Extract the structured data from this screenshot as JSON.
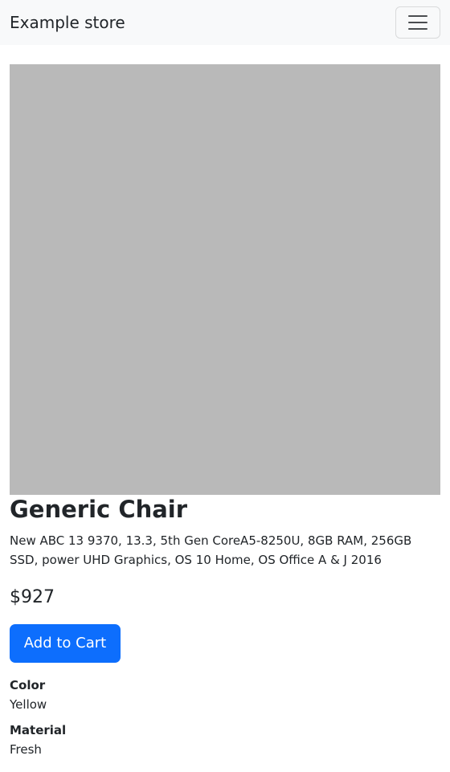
{
  "navbar": {
    "brand": "Example store",
    "toggler_icon": "hamburger-menu-icon"
  },
  "product": {
    "image_placeholder_color": "#b9b9b9",
    "title": "Generic Chair",
    "description": "New ABC 13 9370, 13.3, 5th Gen CoreA5-8250U, 8GB RAM, 256GB SSD, power UHD Graphics, OS 10 Home, OS Office A & J 2016",
    "price": "$927",
    "add_to_cart_label": "Add to Cart",
    "attributes": [
      {
        "label": "Color",
        "value": "Yellow"
      },
      {
        "label": "Material",
        "value": "Fresh"
      }
    ]
  },
  "colors": {
    "navbar_bg": "#f8f9fa",
    "primary_button": "#0d6efd",
    "text": "#212529"
  }
}
